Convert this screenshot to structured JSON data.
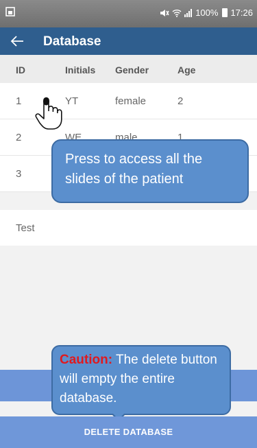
{
  "status_bar": {
    "battery_text": "100%",
    "time": "17:26"
  },
  "app_bar": {
    "title": "Database"
  },
  "table": {
    "columns": [
      "ID",
      "Initials",
      "Gender",
      "Age"
    ],
    "rows": [
      {
        "id": "1",
        "initials": "YT",
        "gender": "female",
        "age": "2"
      },
      {
        "id": "2",
        "initials": "WE",
        "gender": "male",
        "age": "1"
      },
      {
        "id": "3",
        "initials": "",
        "gender": "",
        "age": ""
      }
    ],
    "test_row": "Test"
  },
  "annotations": {
    "press_callout": "Press to access all the slides of the patient",
    "caution_label": "Caution:",
    "caution_text": " The delete button will empty the entire database."
  },
  "delete_button": {
    "label": "DELETE DATABASE"
  },
  "colors": {
    "app_bar": "#2f5e8e",
    "button": "#6f97d9",
    "callout": "#5b8fcd",
    "caution": "#e0191f"
  }
}
